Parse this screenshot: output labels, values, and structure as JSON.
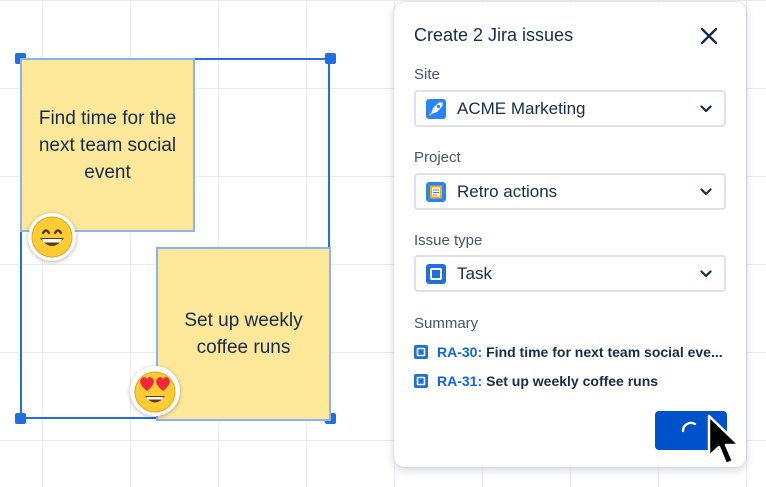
{
  "board": {
    "sticky_1": "Find time for the next team social event",
    "sticky_2": "Set up weekly coffee runs",
    "reaction_1": "grinning-face",
    "reaction_2": "heart-eyes-face"
  },
  "dialog": {
    "title": "Create 2 Jira issues",
    "site": {
      "label": "Site",
      "value": "ACME Marketing",
      "icon": "rocket-icon"
    },
    "project": {
      "label": "Project",
      "value": "Retro actions",
      "icon": "notebook-icon"
    },
    "issue_type": {
      "label": "Issue type",
      "value": "Task",
      "icon": "task-icon"
    },
    "summary": {
      "label": "Summary",
      "items": [
        {
          "key": "RA-30:",
          "text": "Find time for next team social eve..."
        },
        {
          "key": "RA-31:",
          "text": "Set up weekly coffee runs"
        }
      ]
    },
    "create_button": {
      "state": "loading",
      "icon": "spinner-icon"
    }
  },
  "colors": {
    "accent": "#0052cc",
    "selection": "#1f6fe0",
    "sticky": "#fde89a",
    "link": "#0c66e4"
  }
}
